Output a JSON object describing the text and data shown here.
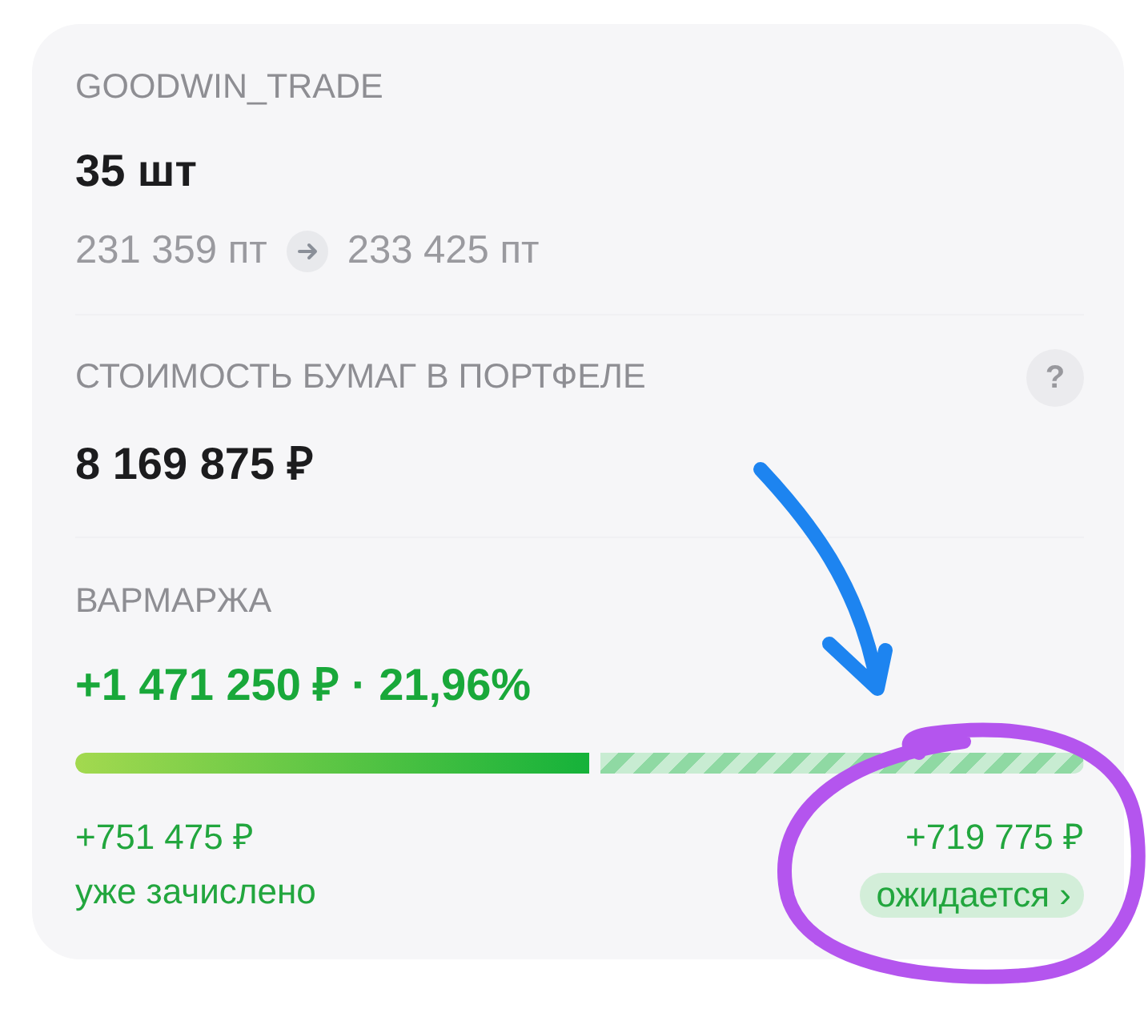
{
  "security": {
    "ticker": "GOODWIN_TRADE",
    "quantity": "35 шт",
    "price_from": "231 359 пт",
    "price_to": "233 425 пт"
  },
  "portfolio_value": {
    "label": "СТОИМОСТЬ БУМАГ В ПОРТФЕЛЕ",
    "value": "8 169 875 ₽",
    "help_button": {
      "label": "?"
    }
  },
  "variation_margin": {
    "label": "ВАРМАРЖА",
    "total": "+1 471 250 ₽ · 21,96%",
    "level": 0.51,
    "credited": {
      "amount": "+751 475 ₽",
      "label": "уже зачислено"
    },
    "pending": {
      "amount": "+719 775 ₽",
      "badge": "ожидается ›"
    }
  },
  "annotations": [
    {
      "kind": "arrow",
      "color": "#1d84f0"
    },
    {
      "kind": "circle",
      "color": "#b455ee"
    }
  ]
}
